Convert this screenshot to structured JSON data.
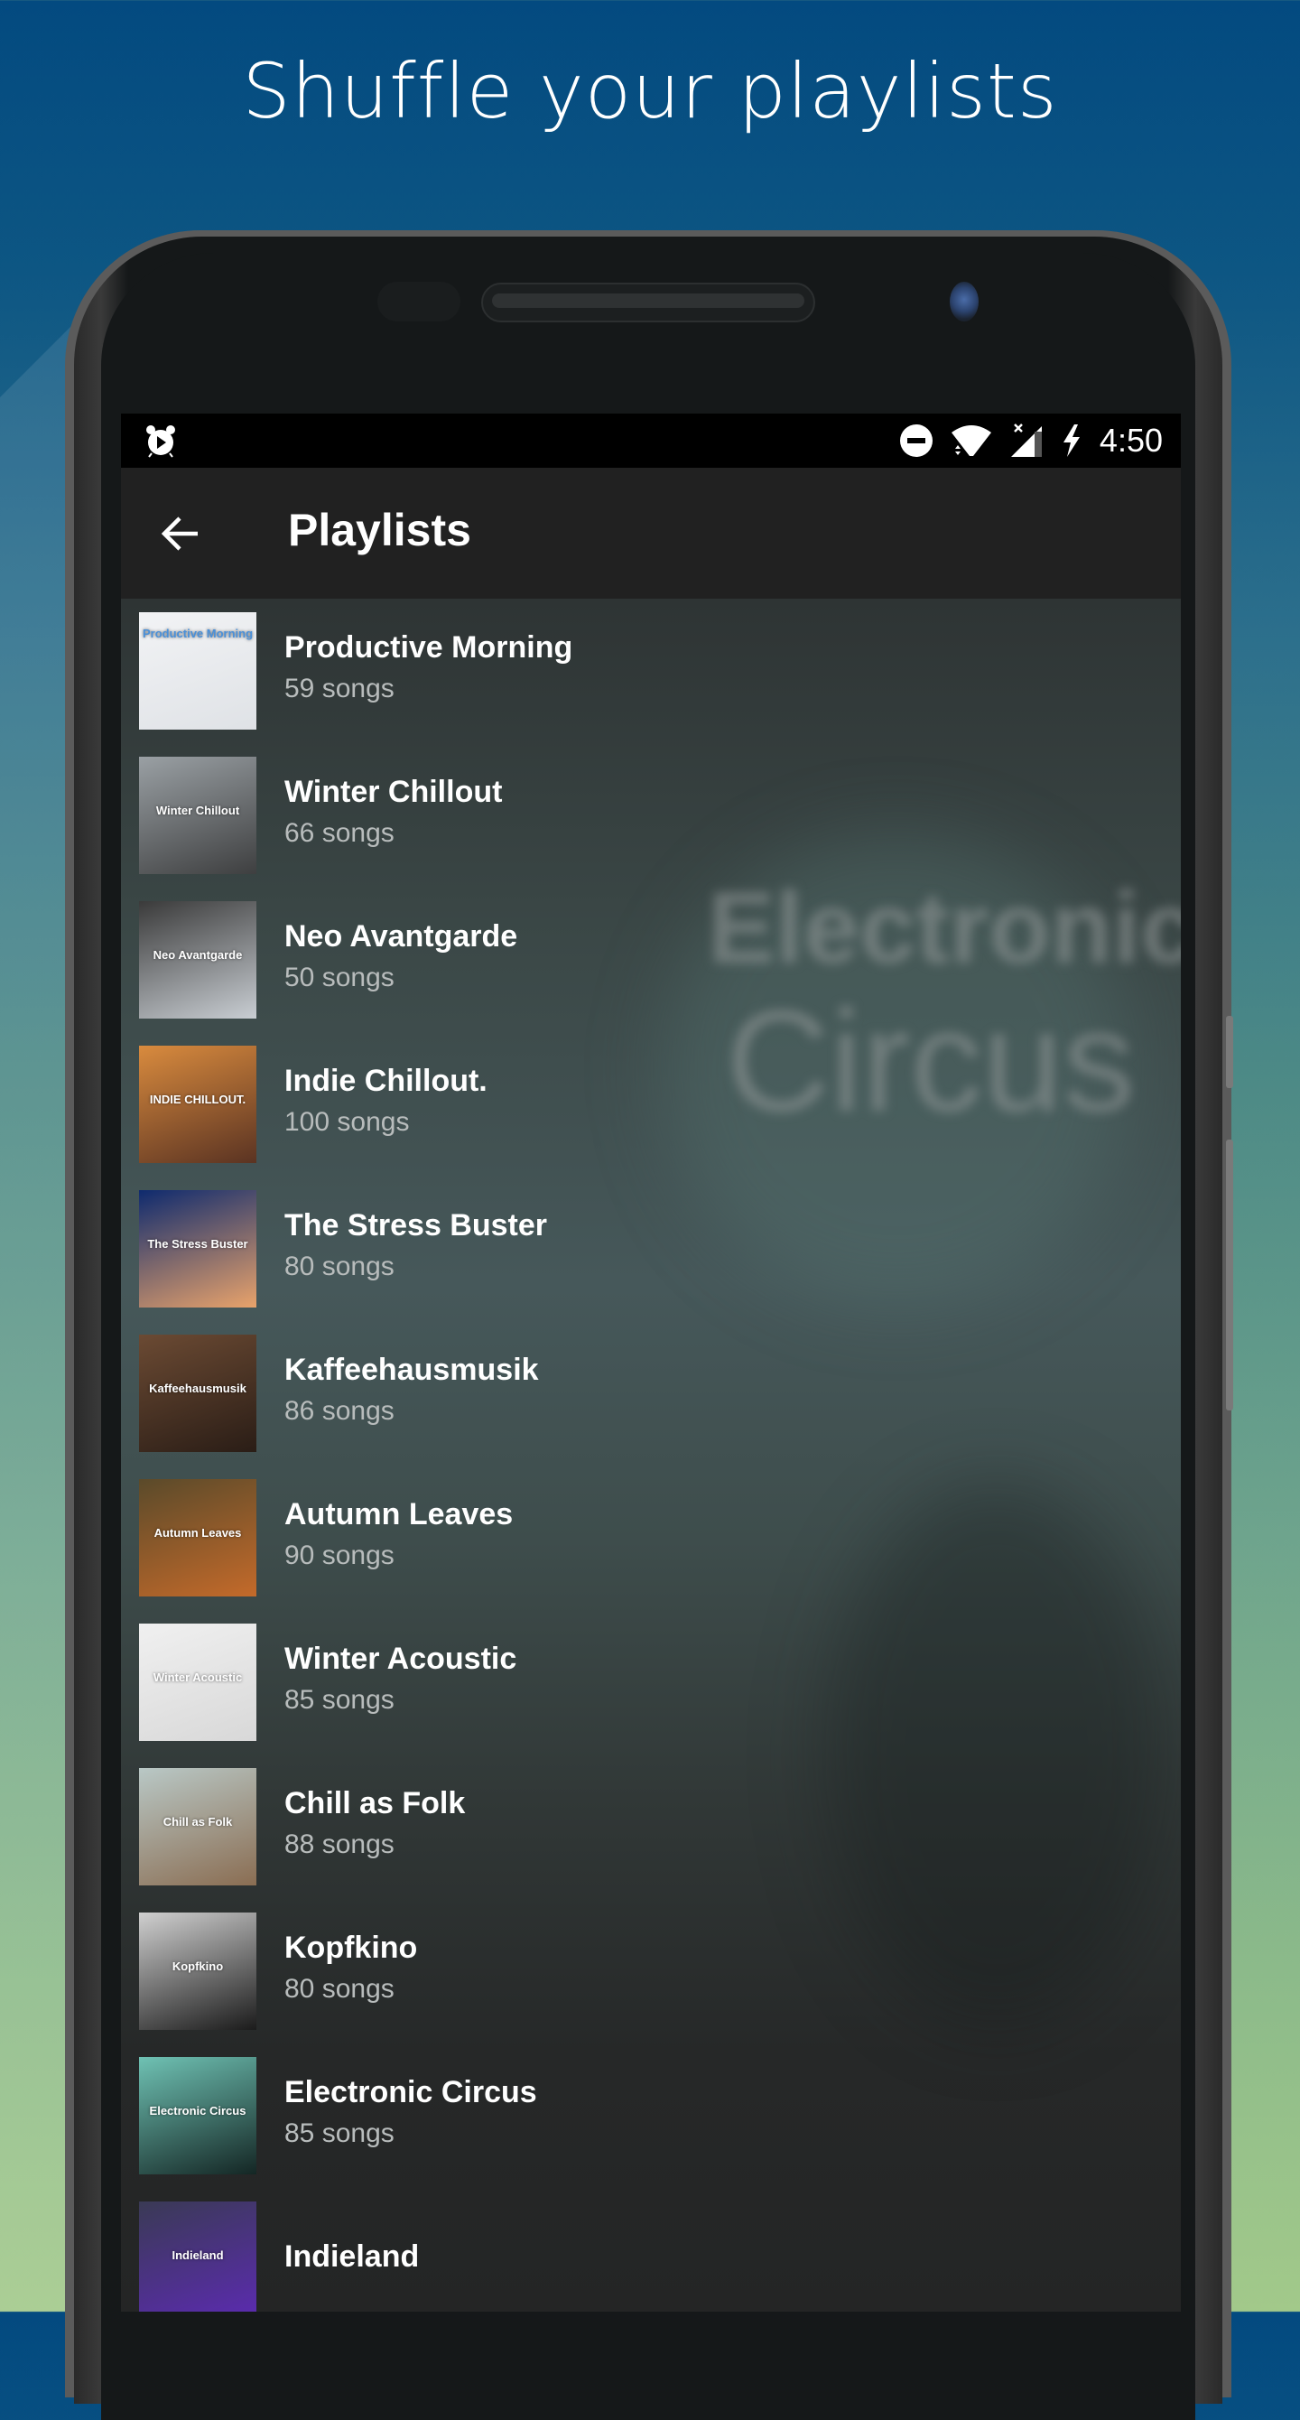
{
  "headline": "Shuffle your playlists",
  "status_bar": {
    "time": "4:50",
    "icons": [
      "alarm-play-icon",
      "do-not-disturb-icon",
      "wifi-icon",
      "cell-signal-no-data-icon",
      "battery-charging-icon"
    ]
  },
  "app_bar": {
    "back_icon": "arrow-left-icon",
    "title": "Playlists"
  },
  "background_art": {
    "line1": "Electronic",
    "line2": "Circus"
  },
  "playlists": [
    {
      "title": "Productive Morning",
      "subtitle": "59 songs",
      "cover_text": "Productive Morning",
      "cover_colors": [
        "#f2f3f5",
        "#dfe2e6"
      ],
      "cover_text_color": "#4a90d9"
    },
    {
      "title": "Winter Chillout",
      "subtitle": "66 songs",
      "cover_text": "Winter Chillout",
      "cover_colors": [
        "#9aa0a4",
        "#3e3f40"
      ],
      "cover_text_color": "#ffffff"
    },
    {
      "title": "Neo Avantgarde",
      "subtitle": "50 songs",
      "cover_text": "Neo Avantgarde",
      "cover_colors": [
        "#3a3a3a",
        "#c9ced3"
      ],
      "cover_text_color": "#ffffff"
    },
    {
      "title": "Indie Chillout.",
      "subtitle": "100 songs",
      "cover_text": "INDIE CHILLOUT.",
      "cover_colors": [
        "#d98b3e",
        "#5a3322"
      ],
      "cover_text_color": "#ffffff"
    },
    {
      "title": "The Stress Buster",
      "subtitle": "80 songs",
      "cover_text": "The Stress Buster",
      "cover_colors": [
        "#0e2a6e",
        "#e9a36b"
      ],
      "cover_text_color": "#ffffff"
    },
    {
      "title": "Kaffeehausmusik",
      "subtitle": "86 songs",
      "cover_text": "Kaffeehausmusik",
      "cover_colors": [
        "#6b4a33",
        "#2a1d16"
      ],
      "cover_text_color": "#ffffff"
    },
    {
      "title": "Autumn Leaves",
      "subtitle": "90 songs",
      "cover_text": "Autumn Leaves",
      "cover_colors": [
        "#5a4a2a",
        "#c46a2a"
      ],
      "cover_text_color": "#ffffff"
    },
    {
      "title": "Winter Acoustic",
      "subtitle": "85 songs",
      "cover_text": "Winter Acoustic",
      "cover_colors": [
        "#f0f0f0",
        "#d8d8d8"
      ],
      "cover_text_color": "#ffffff"
    },
    {
      "title": "Chill as Folk",
      "subtitle": "88 songs",
      "cover_text": "Chill as Folk",
      "cover_colors": [
        "#b9c8c6",
        "#8a6d52"
      ],
      "cover_text_color": "#ffffff"
    },
    {
      "title": "Kopfkino",
      "subtitle": "80 songs",
      "cover_text": "Kopfkino",
      "cover_colors": [
        "#d0d0d0",
        "#1b1b1b"
      ],
      "cover_text_color": "#ffffff"
    },
    {
      "title": "Electronic Circus",
      "subtitle": "85 songs",
      "cover_text": "Electronic Circus",
      "cover_colors": [
        "#6fc2b4",
        "#142624"
      ],
      "cover_text_color": "#ffffff"
    },
    {
      "title": "Indieland",
      "subtitle": "",
      "cover_text": "Indieland",
      "cover_colors": [
        "#3a3a55",
        "#5b2bb0"
      ],
      "cover_text_color": "#ffffff"
    }
  ]
}
